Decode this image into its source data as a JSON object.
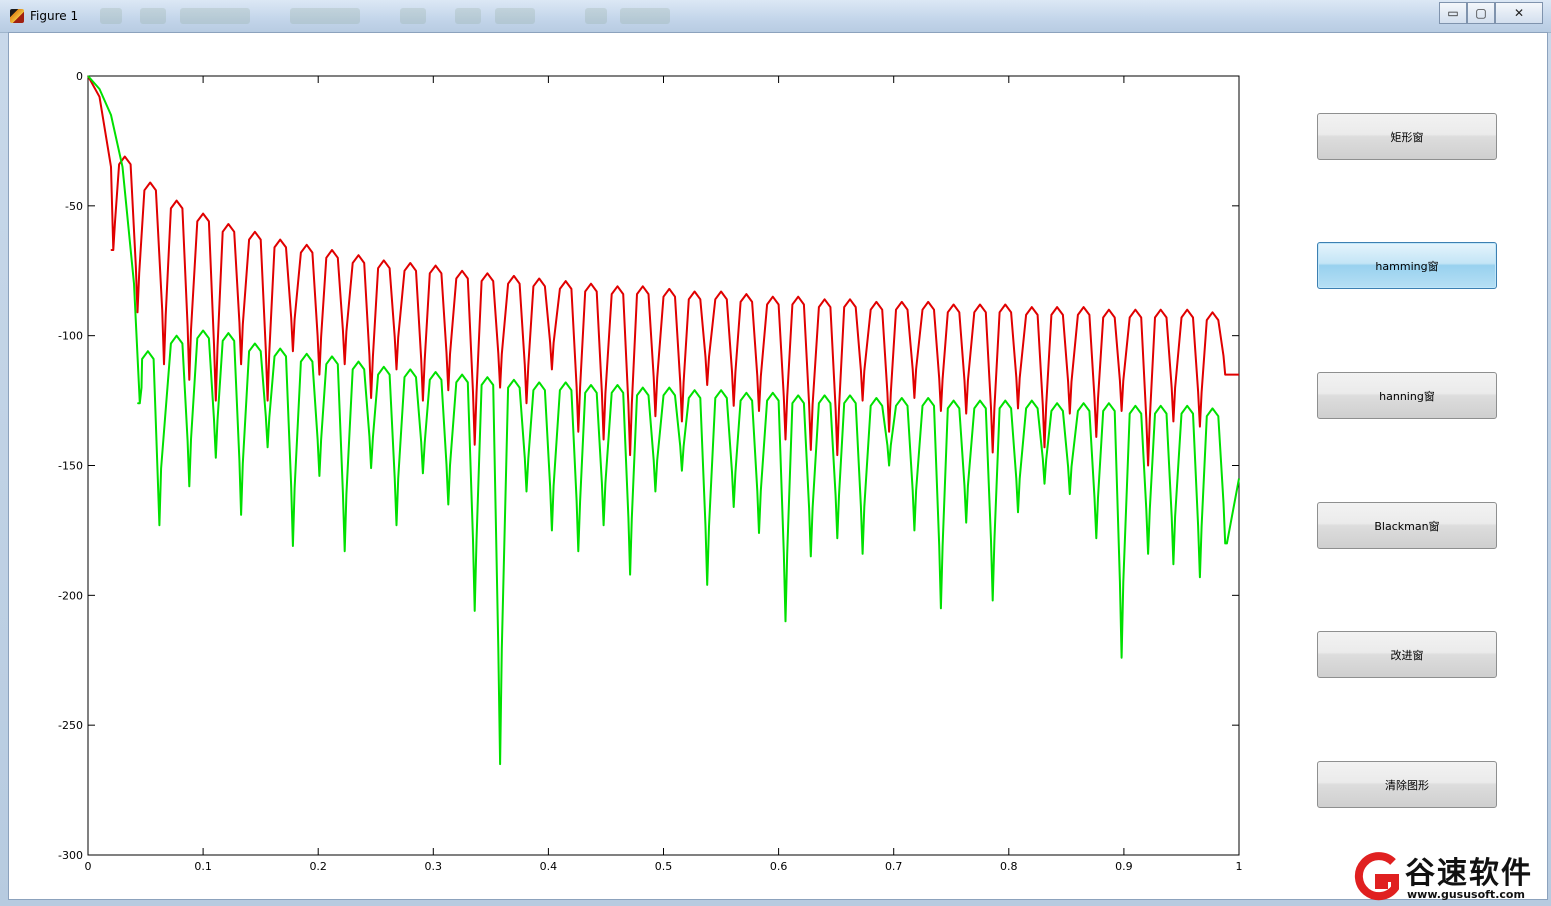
{
  "window": {
    "title": "Figure 1",
    "controls": {
      "minimize": "▭",
      "maximize": "▢",
      "close": "✕"
    }
  },
  "buttons": [
    {
      "label": "矩形窗",
      "active": false
    },
    {
      "label": "hamming窗",
      "active": true
    },
    {
      "label": "hanning窗",
      "active": false
    },
    {
      "label": "Blackman窗",
      "active": false
    },
    {
      "label": "改进窗",
      "active": false
    },
    {
      "label": "清除图形",
      "active": false
    }
  ],
  "watermark": {
    "brand": "谷速软件",
    "url": "www.gususoft.com",
    "color": "#e02020"
  },
  "chart_data": {
    "type": "line",
    "xlim": [
      0,
      1
    ],
    "ylim": [
      -300,
      0
    ],
    "xticks": [
      "0",
      "0.1",
      "0.2",
      "0.3",
      "0.4",
      "0.5",
      "0.6",
      "0.7",
      "0.8",
      "0.9",
      "1"
    ],
    "yticks": [
      "0",
      "-50",
      "-100",
      "-150",
      "-200",
      "-250",
      "-300"
    ],
    "grid": false,
    "series": [
      {
        "color": "#e00000",
        "mainlobe_x": [
          0,
          0.01,
          0.02,
          0.022
        ],
        "mainlobe_y": [
          0,
          -8,
          -35,
          -67
        ],
        "peaks_x": [
          0.032,
          0.054,
          0.077,
          0.1,
          0.122,
          0.145,
          0.167,
          0.19,
          0.212,
          0.235,
          0.257,
          0.28,
          0.302,
          0.325,
          0.347,
          0.37,
          0.392,
          0.415,
          0.437,
          0.46,
          0.482,
          0.505,
          0.527,
          0.55,
          0.572,
          0.595,
          0.617,
          0.64,
          0.662,
          0.685,
          0.707,
          0.73,
          0.752,
          0.775,
          0.797,
          0.82,
          0.842,
          0.865,
          0.887,
          0.91,
          0.932,
          0.955,
          0.977
        ],
        "peaks_y": [
          -31,
          -41,
          -48,
          -53,
          -57,
          -60,
          -63,
          -65,
          -67,
          -69,
          -71,
          -72,
          -73,
          -75,
          -76,
          -77,
          -78,
          -79,
          -80,
          -81,
          -81,
          -82,
          -83,
          -83,
          -84,
          -85,
          -85,
          -86,
          -86,
          -87,
          -87,
          -87,
          -88,
          -88,
          -88,
          -89,
          -89,
          -89,
          -90,
          -90,
          -90,
          -90,
          -91
        ],
        "nulls_x": [
          0.022,
          0.043,
          0.066,
          0.088,
          0.111,
          0.133,
          0.156,
          0.178,
          0.201,
          0.223,
          0.246,
          0.268,
          0.291,
          0.313,
          0.336,
          0.358,
          0.381,
          0.403,
          0.426,
          0.448,
          0.471,
          0.493,
          0.516,
          0.538,
          0.561,
          0.583,
          0.606,
          0.628,
          0.651,
          0.673,
          0.696,
          0.718,
          0.741,
          0.763,
          0.786,
          0.808,
          0.831,
          0.853,
          0.876,
          0.898,
          0.921,
          0.943,
          0.966,
          0.988
        ],
        "nulls_y": [
          -67,
          -91,
          -111,
          -117,
          -125,
          -111,
          -125,
          -106,
          -115,
          -111,
          -124,
          -113,
          -125,
          -121,
          -142,
          -120,
          -126,
          -113,
          -137,
          -140,
          -146,
          -131,
          -133,
          -119,
          -127,
          -129,
          -140,
          -144,
          -146,
          -125,
          -137,
          -124,
          -129,
          -130,
          -145,
          -128,
          -143,
          -130,
          -139,
          -129,
          -150,
          -133,
          -135,
          -115
        ],
        "end": [
          1.0,
          -115
        ]
      },
      {
        "color": "#00e000",
        "mainlobe_x": [
          0,
          0.01,
          0.02,
          0.03,
          0.04,
          0.045
        ],
        "mainlobe_y": [
          0,
          -5,
          -15,
          -35,
          -80,
          -126
        ],
        "peaks_x": [
          0.052,
          0.077,
          0.1,
          0.122,
          0.145,
          0.167,
          0.19,
          0.212,
          0.235,
          0.257,
          0.28,
          0.302,
          0.325,
          0.347,
          0.37,
          0.392,
          0.415,
          0.437,
          0.46,
          0.482,
          0.505,
          0.527,
          0.55,
          0.572,
          0.595,
          0.617,
          0.64,
          0.662,
          0.685,
          0.707,
          0.73,
          0.752,
          0.775,
          0.797,
          0.82,
          0.842,
          0.865,
          0.887,
          0.91,
          0.932,
          0.955,
          0.977
        ],
        "peaks_y": [
          -106,
          -100,
          -98,
          -99,
          -103,
          -105,
          -107,
          -108,
          -110,
          -112,
          -113,
          -114,
          -115,
          -116,
          -117,
          -118,
          -118,
          -119,
          -119,
          -120,
          -120,
          -121,
          -121,
          -122,
          -122,
          -123,
          -123,
          -123,
          -124,
          -124,
          -124,
          -125,
          -125,
          -125,
          -125,
          -126,
          -126,
          -126,
          -127,
          -127,
          -127,
          -128
        ],
        "nulls_x": [
          0.045,
          0.062,
          0.088,
          0.111,
          0.133,
          0.156,
          0.178,
          0.201,
          0.223,
          0.246,
          0.268,
          0.291,
          0.313,
          0.336,
          0.358,
          0.381,
          0.403,
          0.426,
          0.448,
          0.471,
          0.493,
          0.516,
          0.538,
          0.561,
          0.583,
          0.606,
          0.628,
          0.651,
          0.673,
          0.696,
          0.718,
          0.741,
          0.763,
          0.786,
          0.808,
          0.831,
          0.853,
          0.876,
          0.898,
          0.921,
          0.943,
          0.966,
          0.988
        ],
        "nulls_y": [
          -126,
          -173,
          -158,
          -147,
          -169,
          -143,
          -181,
          -154,
          -183,
          -151,
          -173,
          -153,
          -165,
          -206,
          -265,
          -160,
          -175,
          -183,
          -173,
          -192,
          -160,
          -152,
          -196,
          -166,
          -176,
          -210,
          -185,
          -178,
          -184,
          -150,
          -175,
          -205,
          -172,
          -202,
          -168,
          -157,
          -161,
          -178,
          -224,
          -184,
          -188,
          -193,
          -180
        ],
        "end": [
          1.0,
          -155
        ]
      }
    ]
  }
}
